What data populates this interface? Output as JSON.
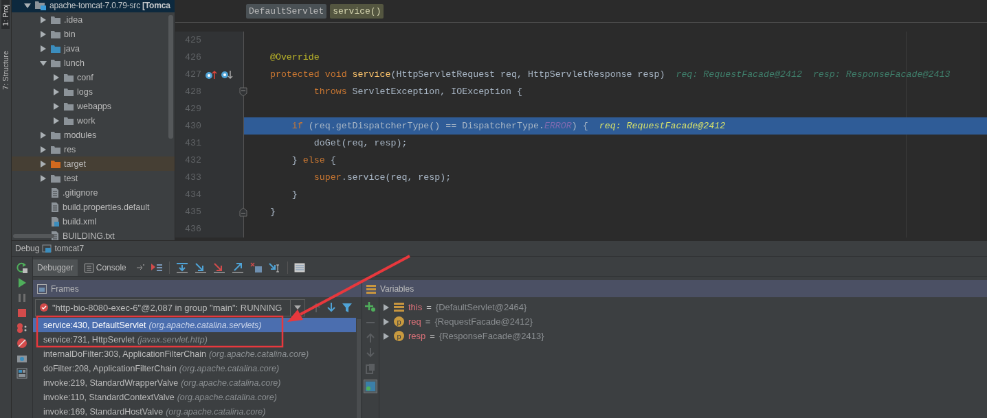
{
  "side_tabs": [
    {
      "label": "1: Proj",
      "selected": true
    },
    {
      "label": "7: Structure",
      "selected": false
    }
  ],
  "project_tree": [
    {
      "label": "apache-tomcat-7.0.79-src **[Tomca**",
      "kind": "module",
      "expanded": true,
      "selected": true,
      "children": [
        {
          "label": ".idea",
          "kind": "folder",
          "expanded": false,
          "selected": false
        },
        {
          "label": "bin",
          "kind": "folder",
          "expanded": false,
          "selected": false
        },
        {
          "label": "java",
          "kind": "source",
          "expanded": false,
          "selected": false
        },
        {
          "label": "lunch",
          "kind": "folder",
          "expanded": true,
          "selected": false,
          "children": [
            {
              "label": "conf",
              "kind": "folder",
              "expanded": false,
              "selected": false
            },
            {
              "label": "logs",
              "kind": "folder",
              "expanded": false,
              "selected": false
            },
            {
              "label": "webapps",
              "kind": "folder",
              "expanded": false,
              "selected": false
            },
            {
              "label": "work",
              "kind": "folder",
              "expanded": false,
              "selected": false
            }
          ]
        },
        {
          "label": "modules",
          "kind": "folder",
          "expanded": false,
          "selected": false
        },
        {
          "label": "res",
          "kind": "folder",
          "expanded": false,
          "selected": false
        },
        {
          "label": "target",
          "kind": "excluded",
          "expanded": false,
          "selected": false
        },
        {
          "label": "test",
          "kind": "folder",
          "expanded": false,
          "selected": false
        },
        {
          "label": ".gitignore",
          "kind": "file",
          "selected": false
        },
        {
          "label": "build.properties.default",
          "kind": "file",
          "selected": false
        },
        {
          "label": "build.xml",
          "kind": "xml",
          "selected": false
        },
        {
          "label": "BUILDING.txt",
          "kind": "file",
          "selected": false
        }
      ]
    }
  ],
  "editor": {
    "breadcrumbs": [
      {
        "label": "DefaultServlet",
        "kind": "class"
      },
      {
        "label": "service()",
        "kind": "method"
      }
    ],
    "lines": [
      {
        "number": "425",
        "current": false,
        "kind": "plain"
      },
      {
        "number": "426",
        "current": false,
        "kind": "plain",
        "tokens": [
          {
            "text": "    @Override",
            "kind": "annotation"
          }
        ]
      },
      {
        "number": "427",
        "current": false,
        "kind": "override-marks",
        "tokens": [
          {
            "text": "    protected void ",
            "kind": "keyword"
          },
          {
            "text": "service",
            "kind": "method"
          },
          {
            "text": "(HttpServletRequest req, HttpServletResponse resp)",
            "kind": "plain"
          },
          {
            "text": "req: RequestFacade@2412",
            "kind": "hint"
          },
          {
            "text": "resp: ResponseFacade@2413",
            "kind": "hint"
          }
        ]
      },
      {
        "number": "428",
        "current": false,
        "kind": "fold-start",
        "tokens": [
          {
            "text": "            throws ",
            "kind": "keyword"
          },
          {
            "text": "ServletException, IOException {",
            "kind": "plain"
          }
        ]
      },
      {
        "number": "429",
        "current": false,
        "kind": "plain"
      },
      {
        "number": "430",
        "current": true,
        "kind": "plain",
        "tokens": [
          {
            "text": "        if ",
            "kind": "keyword"
          },
          {
            "text": "(req.getDispatcherType() == DispatcherType.",
            "kind": "plain"
          },
          {
            "text": "ERROR",
            "kind": "constant"
          },
          {
            "text": ") {",
            "kind": "plain"
          },
          {
            "text": "req: RequestFacade@2412",
            "kind": "hint"
          }
        ]
      },
      {
        "number": "431",
        "current": false,
        "kind": "plain",
        "tokens": [
          {
            "text": "            doGet(req, resp);",
            "kind": "plain"
          }
        ]
      },
      {
        "number": "432",
        "current": false,
        "kind": "plain",
        "tokens": [
          {
            "text": "        } ",
            "kind": "plain"
          },
          {
            "text": "else",
            "kind": "keyword"
          },
          {
            "text": " {",
            "kind": "plain"
          }
        ]
      },
      {
        "number": "433",
        "current": false,
        "kind": "plain",
        "tokens": [
          {
            "text": "            super",
            "kind": "keyword"
          },
          {
            "text": ".service(req, resp);",
            "kind": "plain"
          }
        ]
      },
      {
        "number": "434",
        "current": false,
        "kind": "plain",
        "tokens": [
          {
            "text": "        }",
            "kind": "plain"
          }
        ]
      },
      {
        "number": "435",
        "current": false,
        "kind": "fold-end",
        "tokens": [
          {
            "text": "    }",
            "kind": "plain"
          }
        ]
      },
      {
        "number": "436",
        "current": false,
        "kind": "plain"
      }
    ]
  },
  "debug": {
    "title": "Debug",
    "config": "tomcat7",
    "tabs": [
      {
        "label": "Debugger",
        "selected": true
      },
      {
        "label": "Console",
        "selected": false
      }
    ],
    "frames": {
      "title": "Frames",
      "thread": "\"http-bio-8080-exec-6\"@2,087 in group \"main\": RUNNING",
      "items": [
        {
          "method": "service:430, DefaultServlet",
          "package": "(org.apache.catalina.servlets)",
          "selected": true
        },
        {
          "method": "service:731, HttpServlet",
          "package": "(javax.servlet.http)",
          "selected": false
        },
        {
          "method": "internalDoFilter:303, ApplicationFilterChain",
          "package": "(org.apache.catalina.core)",
          "selected": false
        },
        {
          "method": "doFilter:208, ApplicationFilterChain",
          "package": "(org.apache.catalina.core)",
          "selected": false
        },
        {
          "method": "invoke:219, StandardWrapperValve",
          "package": "(org.apache.catalina.core)",
          "selected": false
        },
        {
          "method": "invoke:110, StandardContextValve",
          "package": "(org.apache.catalina.core)",
          "selected": false
        },
        {
          "method": "invoke:169, StandardHostValve",
          "package": "(org.apache.catalina.core)",
          "selected": false
        }
      ]
    },
    "variables": {
      "title": "Variables",
      "items": [
        {
          "name": "this",
          "separator": "=",
          "value": "{DefaultServlet@2464}",
          "kind": "field"
        },
        {
          "name": "req",
          "separator": "=",
          "value": "{RequestFacade@2412}",
          "kind": "param",
          "badge": "p"
        },
        {
          "name": "resp",
          "separator": "=",
          "value": "{ResponseFacade@2413}",
          "kind": "param",
          "badge": "p"
        }
      ]
    }
  }
}
